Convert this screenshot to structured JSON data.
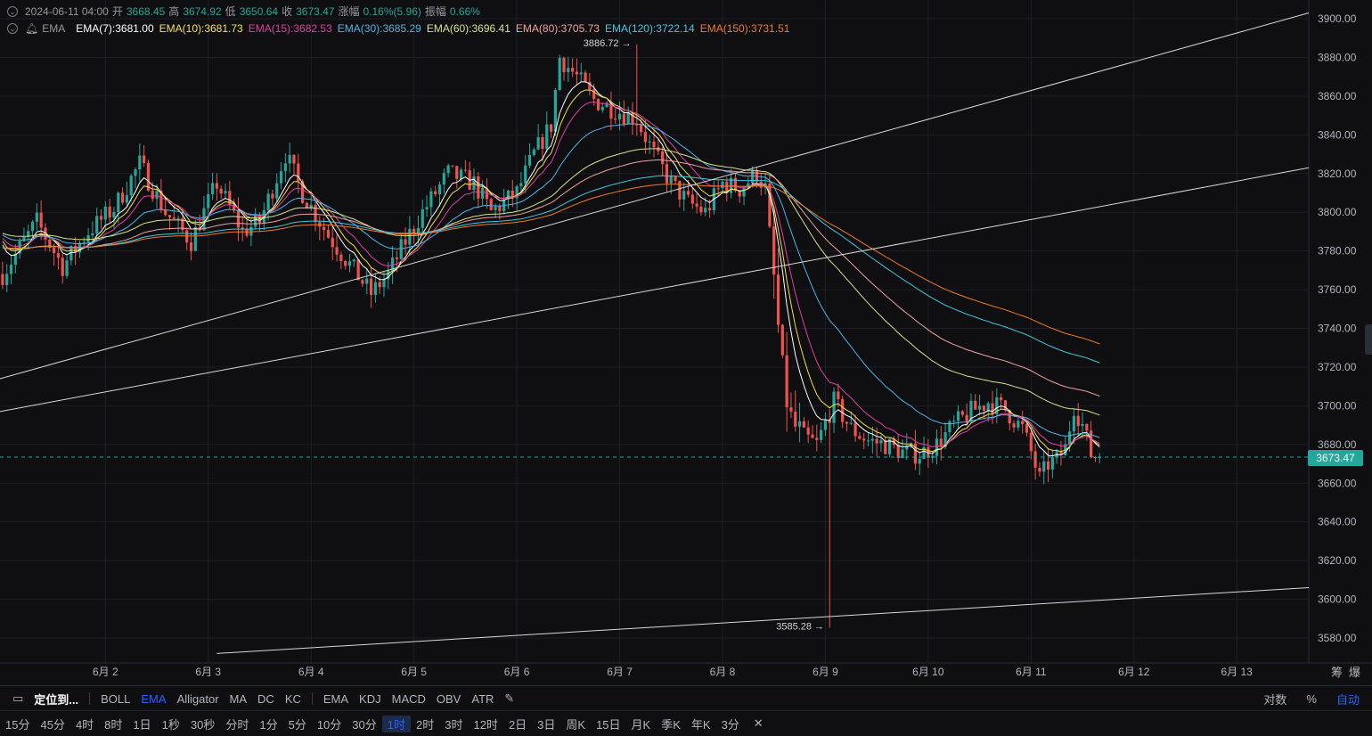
{
  "legend": {
    "date": "2024-06-11 04:00",
    "open_label": "开",
    "open": "3668.45",
    "high_label": "高",
    "high": "3674.92",
    "low_label": "低",
    "low": "3650.64",
    "close_label": "收",
    "close": "3673.47",
    "change_label": "涨幅",
    "change": "0.16%(5.96)",
    "amp_label": "振幅",
    "amp": "0.66%",
    "indicator_name": "EMA",
    "emas": [
      {
        "text": "EMA(7):3681.00",
        "color": "#ffffff"
      },
      {
        "text": "EMA(10):3681.73",
        "color": "#f3e14a"
      },
      {
        "text": "EMA(15):3682.53",
        "color": "#e040a0"
      },
      {
        "text": "EMA(30):3685.29",
        "color": "#4fb4e8"
      },
      {
        "text": "EMA(60):3696.41",
        "color": "#d4e38a"
      },
      {
        "text": "EMA(80):3705.73",
        "color": "#f2a0a0"
      },
      {
        "text": "EMA(120):3722.14",
        "color": "#3fc8e0"
      },
      {
        "text": "EMA(150):3731.51",
        "color": "#f07a28"
      }
    ]
  },
  "chart_data": {
    "type": "candlestick",
    "interval": "1时",
    "ylim": [
      3572,
      3905
    ],
    "y_ticks": [
      "3900.00",
      "3880.00",
      "3860.00",
      "3840.00",
      "3820.00",
      "3800.00",
      "3780.00",
      "3760.00",
      "3740.00",
      "3720.00",
      "3700.00",
      "3680.00",
      "3660.00",
      "3640.00",
      "3620.00",
      "3600.00",
      "3580.00"
    ],
    "x_ticks": [
      {
        "label": "6月 2",
        "hour": 48
      },
      {
        "label": "6月 3",
        "hour": 72
      },
      {
        "label": "6月 4",
        "hour": 96
      },
      {
        "label": "6月 5",
        "hour": 120
      },
      {
        "label": "6月 6",
        "hour": 144
      },
      {
        "label": "6月 7",
        "hour": 168
      },
      {
        "label": "6月 8",
        "hour": 192
      },
      {
        "label": "6月 9",
        "hour": 216
      },
      {
        "label": "6月 10",
        "hour": 240
      },
      {
        "label": "6月 11",
        "hour": 264
      },
      {
        "label": "6月 12",
        "hour": 288
      },
      {
        "label": "6月 13",
        "hour": 312
      }
    ],
    "xlim_hours": [
      23.4,
      328.8
    ],
    "current_price": "3673.47",
    "last_close": 3673.47,
    "high_annotation": {
      "text": "3886.72",
      "hour": 148,
      "price": 3886.72
    },
    "low_annotation": {
      "text": "3585.28",
      "hour": 193,
      "price": 3585.28
    },
    "anchors": [
      [
        0,
        3768
      ],
      [
        8,
        3795
      ],
      [
        14,
        3772
      ],
      [
        20,
        3790
      ],
      [
        26,
        3802
      ],
      [
        32,
        3825
      ],
      [
        38,
        3800
      ],
      [
        44,
        3785
      ],
      [
        50,
        3815
      ],
      [
        56,
        3790
      ],
      [
        60,
        3795
      ],
      [
        66,
        3830
      ],
      [
        70,
        3810
      ],
      [
        76,
        3788
      ],
      [
        82,
        3770
      ],
      [
        86,
        3758
      ],
      [
        90,
        3768
      ],
      [
        94,
        3785
      ],
      [
        98,
        3800
      ],
      [
        104,
        3820
      ],
      [
        110,
        3815
      ],
      [
        114,
        3800
      ],
      [
        120,
        3810
      ],
      [
        124,
        3830
      ],
      [
        128,
        3845
      ],
      [
        130,
        3880
      ],
      [
        134,
        3870
      ],
      [
        138,
        3858
      ],
      [
        144,
        3852
      ],
      [
        148,
        3848
      ],
      [
        152,
        3830
      ],
      [
        156,
        3815
      ],
      [
        160,
        3805
      ],
      [
        164,
        3800
      ],
      [
        168,
        3815
      ],
      [
        172,
        3812
      ],
      [
        176,
        3820
      ],
      [
        178,
        3812
      ],
      [
        180,
        3765
      ],
      [
        182,
        3715
      ],
      [
        184,
        3692
      ],
      [
        186,
        3685
      ],
      [
        190,
        3680
      ],
      [
        194,
        3702
      ],
      [
        198,
        3688
      ],
      [
        202,
        3682
      ],
      [
        206,
        3680
      ],
      [
        210,
        3676
      ],
      [
        214,
        3675
      ],
      [
        218,
        3680
      ],
      [
        222,
        3690
      ],
      [
        226,
        3697
      ],
      [
        230,
        3702
      ],
      [
        234,
        3698
      ],
      [
        238,
        3688
      ],
      [
        240,
        3676
      ],
      [
        242,
        3662
      ],
      [
        244,
        3670
      ],
      [
        246,
        3672
      ],
      [
        248,
        3678
      ],
      [
        250,
        3700
      ],
      [
        252,
        3690
      ],
      [
        254,
        3675
      ],
      [
        256,
        3673
      ]
    ],
    "ema_lines": [
      {
        "name": "EMA(7)",
        "period": 7,
        "color": "#ffffff"
      },
      {
        "name": "EMA(10)",
        "period": 10,
        "color": "#f3e14a"
      },
      {
        "name": "EMA(15)",
        "period": 15,
        "color": "#e040a0"
      },
      {
        "name": "EMA(30)",
        "period": 30,
        "color": "#4fb4e8"
      },
      {
        "name": "EMA(60)",
        "period": 60,
        "color": "#d4e38a"
      },
      {
        "name": "EMA(80)",
        "period": 80,
        "color": "#f2a0a0"
      },
      {
        "name": "EMA(120)",
        "period": 120,
        "color": "#3fc8e0"
      },
      {
        "name": "EMA(150)",
        "period": 150,
        "color": "#f07a28"
      }
    ],
    "trend_lines": [
      {
        "h1": 23.4,
        "p1": 3714,
        "h2": 328.8,
        "p2": 3903
      },
      {
        "h1": 23.4,
        "p1": 3697,
        "h2": 328.8,
        "p2": 3823
      },
      {
        "h1": 74,
        "p1": 3572,
        "h2": 328.8,
        "p2": 3606
      }
    ],
    "colors": {
      "up": "#26a69a",
      "down": "#ef5350",
      "grid": "#1c1f26",
      "axis_text": "#b2b5be"
    },
    "grid": true
  },
  "toolbar1": {
    "locate": "定位到...",
    "indicators_main": [
      "BOLL",
      "EMA",
      "Alligator",
      "MA",
      "DC",
      "KC"
    ],
    "indicators_sub": [
      "EMA",
      "KDJ",
      "MACD",
      "OBV",
      "ATR"
    ],
    "right": [
      "对数",
      "%",
      "自动"
    ]
  },
  "toolbar2": {
    "intervals": [
      "15分",
      "45分",
      "4时",
      "8时",
      "1日",
      "1秒",
      "30秒",
      "分时",
      "1分",
      "5分",
      "10分",
      "30分",
      "1时",
      "2时",
      "3时",
      "12时",
      "2日",
      "3日",
      "周K",
      "15日",
      "月K",
      "季K",
      "年K",
      "3分"
    ]
  },
  "corner_labels": {
    "a": "筹",
    "b": "爆"
  }
}
